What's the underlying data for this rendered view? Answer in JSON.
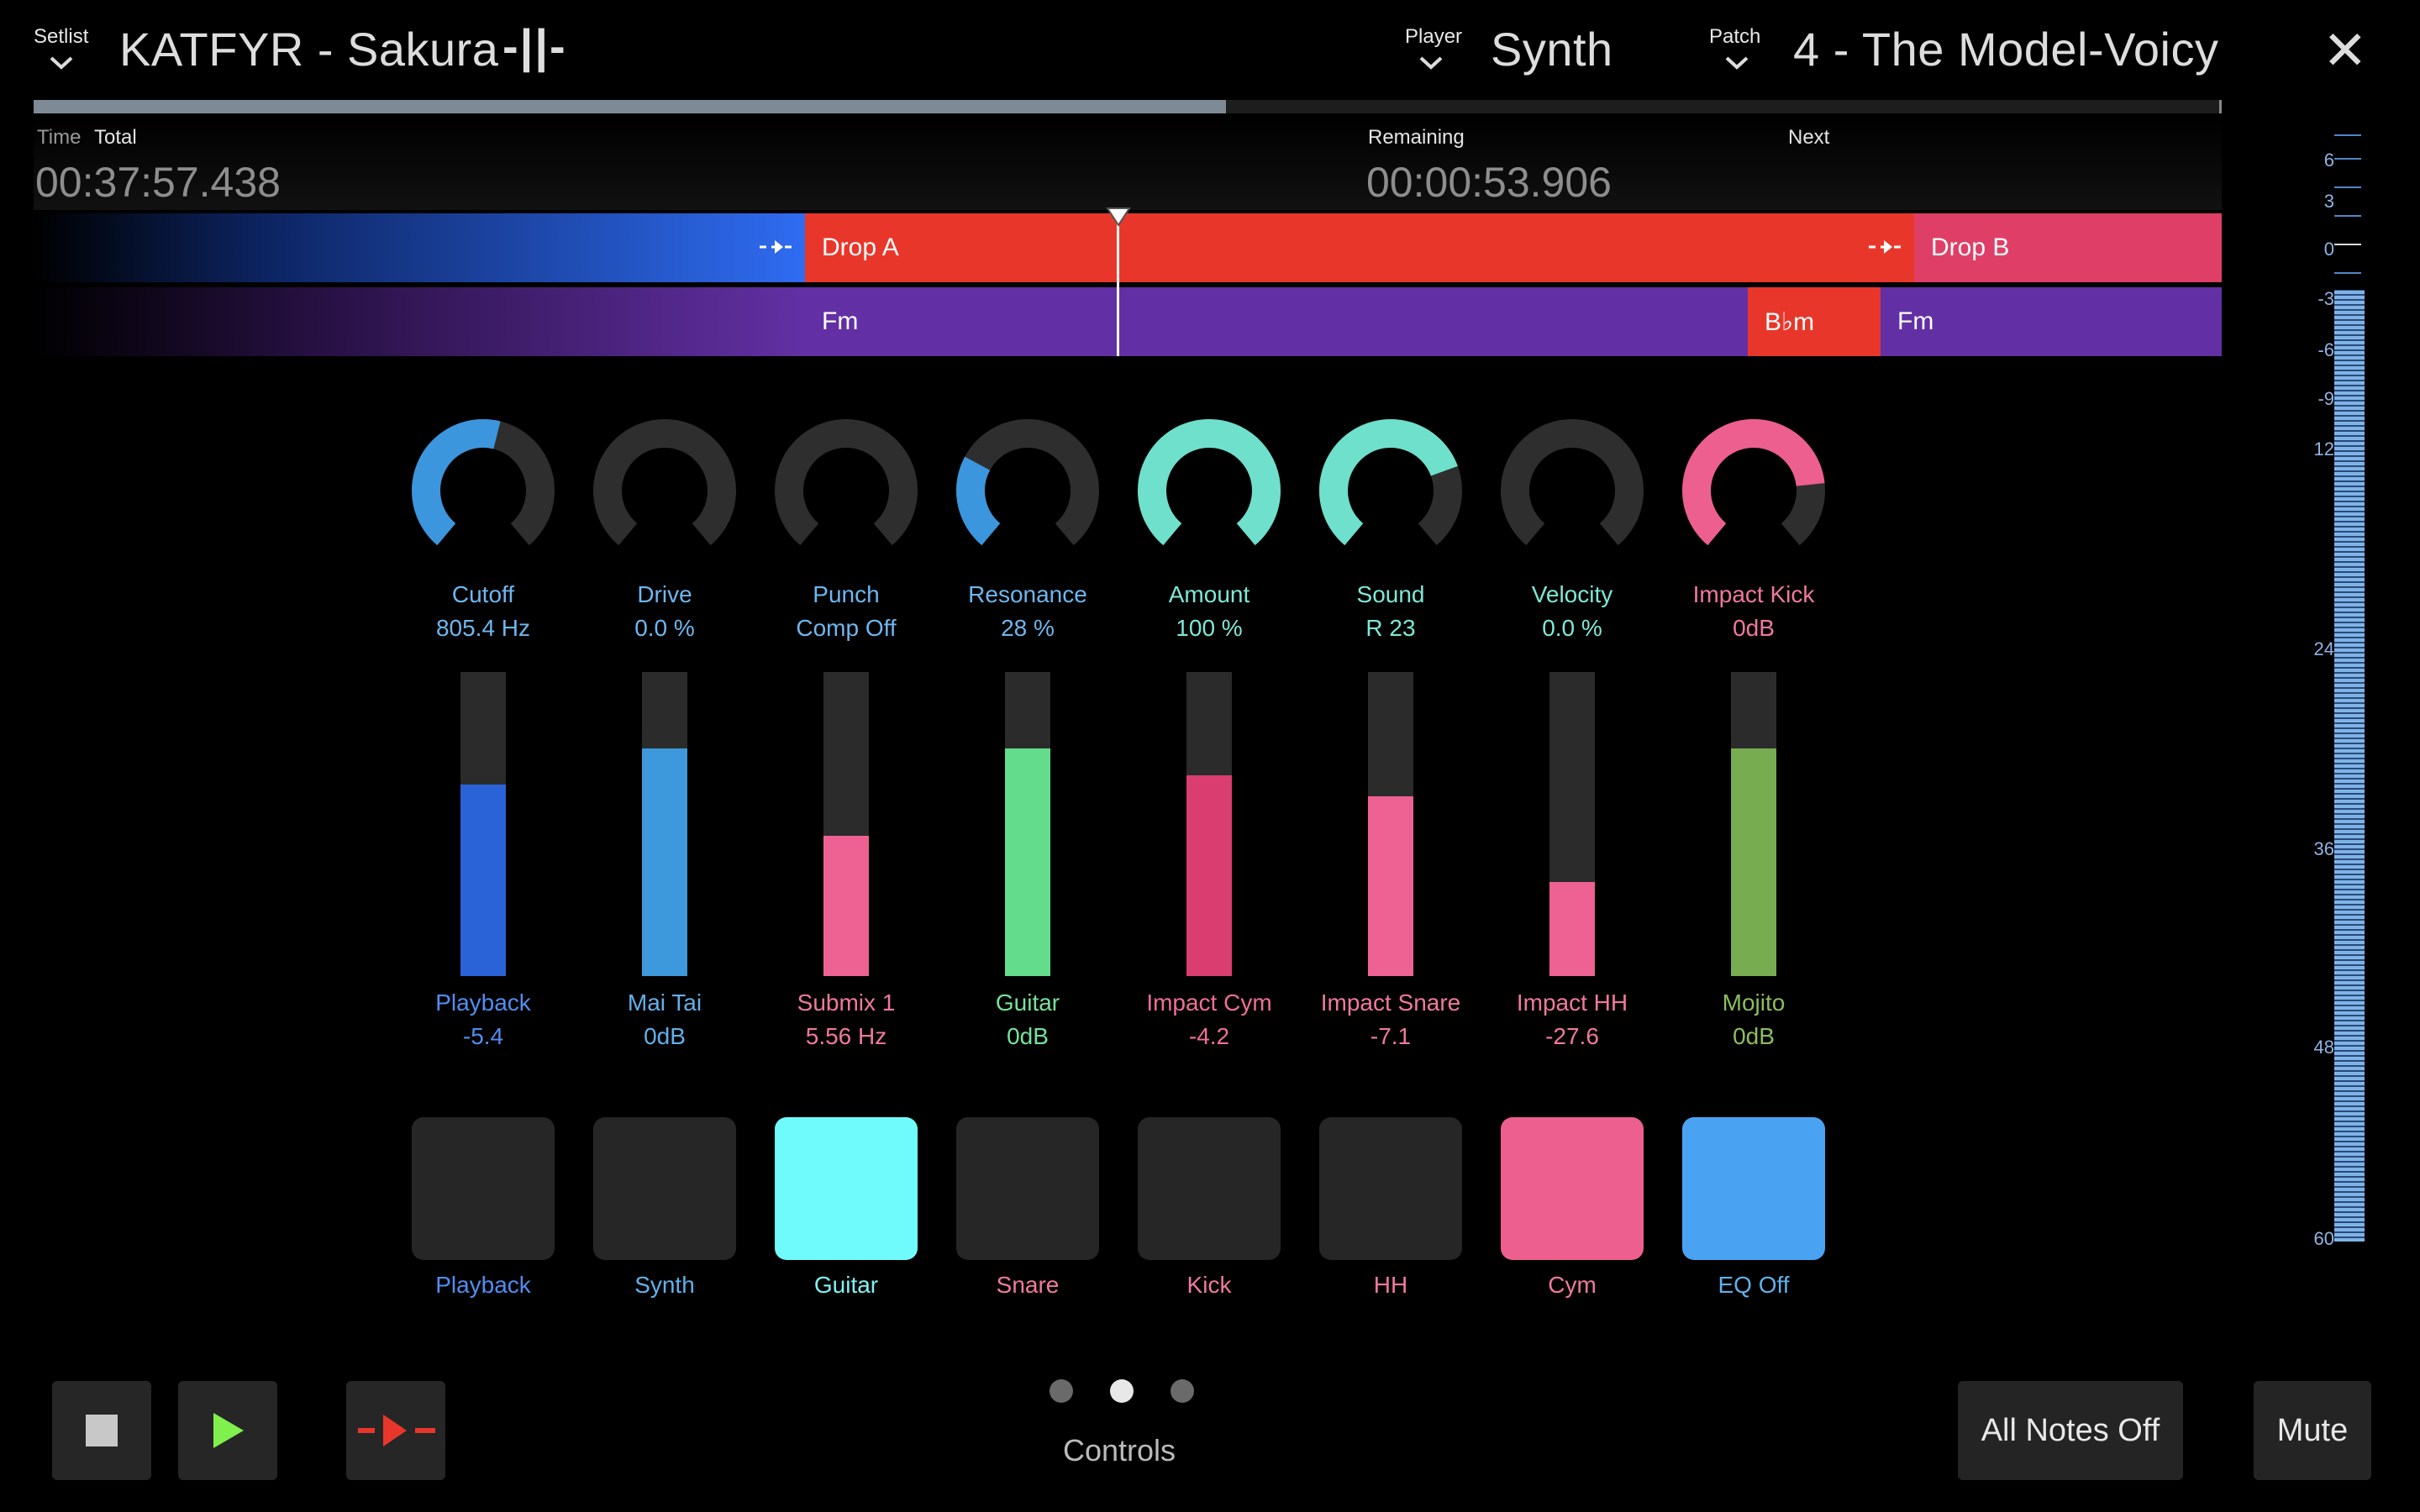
{
  "header": {
    "setlist_label": "Setlist",
    "song_title": "KATFYR - Sakura",
    "song_marker_glyph": "-||-",
    "player_label": "Player",
    "player_value": "Synth",
    "patch_label": "Patch",
    "patch_value": "4 - The Model-Voicy",
    "close_glyph": "✕"
  },
  "progress": {
    "fraction": 0.545
  },
  "time": {
    "time_label": "Time",
    "total_label": "Total",
    "elapsed": "00:37:57.438",
    "remaining_label": "Remaining",
    "remaining": "00:00:53.906",
    "next_label": "Next"
  },
  "arranger": {
    "sections": [
      "Drop A",
      "Drop B"
    ],
    "chords": [
      "Fm",
      "B♭m",
      "Fm"
    ],
    "colors": {
      "intro_blue": "#2f6cf2",
      "drop_a": "#e8372a",
      "drop_b": "#df3f66",
      "chord": "#6230a4",
      "chord_alt": "#e8372a"
    }
  },
  "knobs": [
    {
      "label": "Cutoff",
      "value": "805.4 Hz",
      "level": 0.55,
      "color": "#3b96dd",
      "text_color": "#6fb6ee"
    },
    {
      "label": "Drive",
      "value": "0.0 %",
      "level": 0.0,
      "color": "#3b96dd",
      "text_color": "#6fb6ee"
    },
    {
      "label": "Punch",
      "value": "Comp Off",
      "level": 0.0,
      "color": "#3b96dd",
      "text_color": "#6fb6ee"
    },
    {
      "label": "Resonance",
      "value": "28 %",
      "level": 0.28,
      "color": "#3b96dd",
      "text_color": "#6fb6ee"
    },
    {
      "label": "Amount",
      "value": "100 %",
      "level": 1.0,
      "color": "#6ee0cb",
      "text_color": "#7fe8d5"
    },
    {
      "label": "Sound",
      "value": "R 23",
      "level": 0.75,
      "color": "#6ee0cb",
      "text_color": "#7fe8d5"
    },
    {
      "label": "Velocity",
      "value": "0.0 %",
      "level": 0.0,
      "color": "#6ee0cb",
      "text_color": "#7fe8d5"
    },
    {
      "label": "Impact Kick",
      "value": "0dB",
      "level": 0.8,
      "color": "#ed5f8e",
      "text_color": "#f0799f"
    }
  ],
  "faders": [
    {
      "label": "Playback",
      "value": "-5.4",
      "level": 0.63,
      "color": "#2a62d8",
      "text_color": "#4f8ef0"
    },
    {
      "label": "Mai Tai",
      "value": "0dB",
      "level": 0.75,
      "color": "#3d99db",
      "text_color": "#62b0ea"
    },
    {
      "label": "Submix 1",
      "value": "5.56 Hz",
      "level": 0.46,
      "color": "#ee6293",
      "text_color": "#f079a0"
    },
    {
      "label": "Guitar",
      "value": "0dB",
      "level": 0.75,
      "color": "#63dc8b",
      "text_color": "#74e39a"
    },
    {
      "label": "Impact Cym",
      "value": "-4.2",
      "level": 0.66,
      "color": "#da3d70",
      "text_color": "#ee6f98"
    },
    {
      "label": "Impact Snare",
      "value": "-7.1",
      "level": 0.59,
      "color": "#ee6293",
      "text_color": "#f079a0"
    },
    {
      "label": "Impact HH",
      "value": "-27.6",
      "level": 0.31,
      "color": "#ee6293",
      "text_color": "#f079a0"
    },
    {
      "label": "Mojito",
      "value": "0dB",
      "level": 0.75,
      "color": "#77ac51",
      "text_color": "#8cbd62"
    }
  ],
  "pads": [
    {
      "label": "Playback",
      "color": "#262626",
      "text_color": "#4f8ef0"
    },
    {
      "label": "Synth",
      "color": "#262626",
      "text_color": "#62b0ea"
    },
    {
      "label": "Guitar",
      "color": "#6ffbfc",
      "text_color": "#7ff2f2"
    },
    {
      "label": "Snare",
      "color": "#262626",
      "text_color": "#f079a0"
    },
    {
      "label": "Kick",
      "color": "#262626",
      "text_color": "#f079a0"
    },
    {
      "label": "HH",
      "color": "#262626",
      "text_color": "#f079a0"
    },
    {
      "label": "Cym",
      "color": "#ed5f8e",
      "text_color": "#f079a0"
    },
    {
      "label": "EQ Off",
      "color": "#4aa3f2",
      "text_color": "#62b0ea"
    }
  ],
  "footer": {
    "page_label": "Controls",
    "all_notes_off": "All Notes Off",
    "mute": "Mute"
  },
  "meter": {
    "scale": [
      "6",
      "3",
      "0",
      "-3",
      "-6",
      "-9",
      "12",
      "24",
      "36",
      "48",
      "60"
    ],
    "level": 0.86
  }
}
